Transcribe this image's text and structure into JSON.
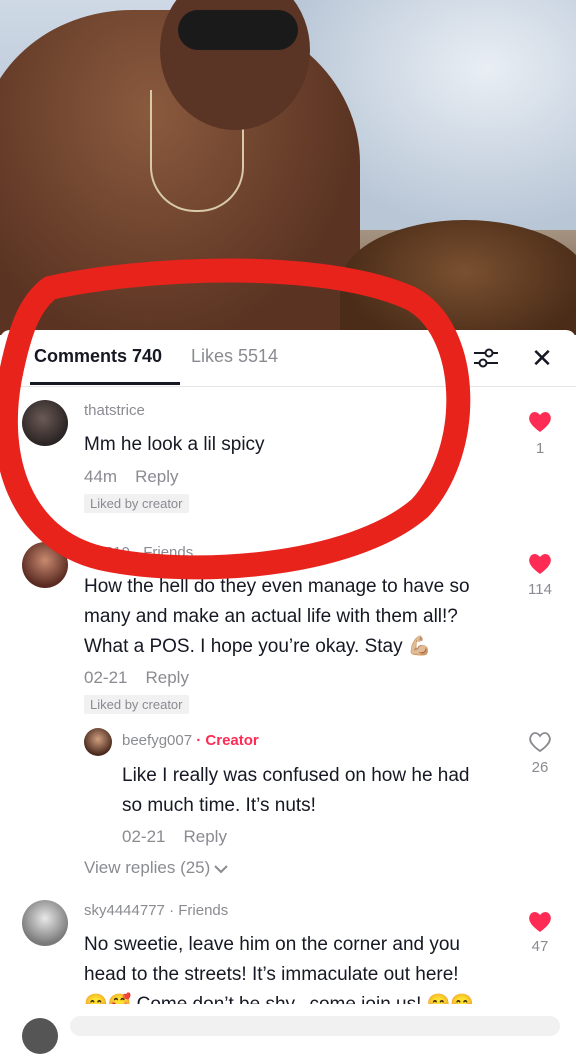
{
  "tabs": {
    "comments": "Comments 740",
    "likes": "Likes 5514"
  },
  "icons": {
    "filter": "filter-icon",
    "close": "close-icon",
    "heart": "heart-icon",
    "chevron": "chevron-down-icon"
  },
  "colors": {
    "accent": "#fe2c55",
    "annotation": "#e8231c",
    "text": "#161823",
    "muted": "#8a8b91"
  },
  "comments": [
    {
      "username": "thatstrice",
      "text": "Mm he look a lil spicy",
      "time": "44m",
      "reply": "Reply",
      "badge": "Liked by creator",
      "likes": "1",
      "liked": true
    },
    {
      "username_partial": "...0310",
      "friends": "· Friends",
      "text": "How the hell do they even manage to have so many and make an actual life with them all!? What a POS. I hope you’re okay. Stay 💪🏼",
      "lines": [
        "How the hell do they even manage to have so",
        "many and make an actual life with them all!?",
        "What a POS. I hope you’re okay. Stay 💪🏼"
      ],
      "time": "02-21",
      "reply": "Reply",
      "badge": "Liked by creator",
      "likes": "114",
      "liked": true,
      "replies": [
        {
          "username": "beefyg007",
          "role": "· Creator",
          "lines": [
            "Like I really was confused on how he had",
            "so much time. It’s nuts!"
          ],
          "time": "02-21",
          "reply": "Reply",
          "likes": "26",
          "liked": false
        }
      ],
      "view_replies": "View replies (25)"
    },
    {
      "username": "sky4444777",
      "friends": "· Friends",
      "lines": [
        "No sweetie, leave him on the corner and you",
        "head to the streets! It’s immaculate out here!",
        "😊🥰 Come don’t be shy...come join us! 😊😊"
      ],
      "likes": "47",
      "liked": true
    }
  ]
}
